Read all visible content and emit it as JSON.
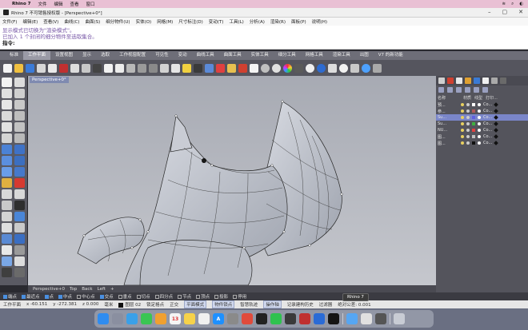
{
  "mac_menu": {
    "app": "Rhino 7",
    "items": [
      "文件",
      "编辑",
      "查看",
      "窗口"
    ],
    "right_icons": [
      "wifi-icon",
      "search-icon",
      "control-center-icon"
    ]
  },
  "window": {
    "title": "Rhino 7 不可销售授权版 - [Perspective+0°]"
  },
  "menu": [
    "文件(F)",
    "编辑(E)",
    "查看(V)",
    "曲线(C)",
    "曲面(S)",
    "细分物件(U)",
    "实体(O)",
    "网格(M)",
    "尺寸标注(D)",
    "变动(T)",
    "工具(L)",
    "分析(A)",
    "渲染(R)",
    "面板(P)",
    "说明(H)"
  ],
  "command": {
    "line1": "显示模式已切换为\"渲染模式\"。",
    "line2": "已加入 1 个封闭的细分物件至选取集合。",
    "prompt": "指令:"
  },
  "toolbar_tabs": [
    "标准",
    "工作平面",
    "设置视图",
    "显示",
    "选取",
    "工作视窗配置",
    "可见性",
    "变动",
    "曲线工具",
    "曲面工具",
    "实体工具",
    "细分工具",
    "网格工具",
    "渲染工具",
    "出图",
    "V7 的新功能"
  ],
  "active_toolbar_tab": 1,
  "viewport": {
    "label": "Perspective+0°"
  },
  "view_tabs": [
    "Perspective+0",
    "Top",
    "Back",
    "Left",
    "+"
  ],
  "osnaps": [
    {
      "label": "端点",
      "on": true
    },
    {
      "label": "最近点",
      "on": true
    },
    {
      "label": "点",
      "on": true
    },
    {
      "label": "中点",
      "on": true
    },
    {
      "label": "中心点",
      "on": false
    },
    {
      "label": "交点",
      "on": true
    },
    {
      "label": "垂点",
      "on": false
    },
    {
      "label": "切点",
      "on": false
    },
    {
      "label": "四分点",
      "on": false
    },
    {
      "label": "节点",
      "on": false
    },
    {
      "label": "顶点",
      "on": false
    },
    {
      "label": "投影",
      "on": false
    },
    {
      "label": "停用",
      "on": false
    }
  ],
  "status": {
    "workplane": "工作平面",
    "x": "x -60.151",
    "y": "y -272.381",
    "z": "z 0.000",
    "unit": "毫米",
    "layer": "图层 02",
    "lock_grid": "锁定格点",
    "ortho": "正交",
    "planar": "平面模式",
    "osnap": "物件锁点",
    "smart_track": "智慧轨迹",
    "gumball": "操作轴",
    "record_history": "记录建构历史",
    "filter": "过滤器",
    "tolerance": "绝对公差: 0.001"
  },
  "tooltip": "Rhino 7",
  "layers": {
    "headers": [
      "名称",
      "材质",
      "线型",
      "打印..."
    ],
    "rows": [
      {
        "name": "预...",
        "color": "#ffffff",
        "selected": false
      },
      {
        "name": "参...",
        "color": "#b05a5a",
        "selected": false
      },
      {
        "name": "Su...",
        "color": "#6060e0",
        "selected": true
      },
      {
        "name": "Su...",
        "color": "#3fb040",
        "selected": false
      },
      {
        "name": "NU...",
        "color": "#e04040",
        "selected": false
      },
      {
        "name": "图...",
        "color": "#c0c0c0",
        "selected": false
      },
      {
        "name": "图...",
        "color": "#101010",
        "selected": false
      }
    ],
    "linetype": "Co..."
  },
  "dock": [
    {
      "name": "finder-icon",
      "color": "#2f8cf0",
      "glyph": ""
    },
    {
      "name": "launchpad-icon",
      "color": "#8a8fa0",
      "glyph": ""
    },
    {
      "name": "safari-icon",
      "color": "#3aa0e8",
      "glyph": ""
    },
    {
      "name": "messages-icon",
      "color": "#3ac553",
      "glyph": ""
    },
    {
      "name": "photos-icon",
      "color": "#f0a030",
      "glyph": ""
    },
    {
      "name": "calendar-icon",
      "color": "#f4f4f4",
      "glyph": "13"
    },
    {
      "name": "notes-icon",
      "color": "#f6d24a",
      "glyph": ""
    },
    {
      "name": "reminders-icon",
      "color": "#f0f0f0",
      "glyph": ""
    },
    {
      "name": "appstore-icon",
      "color": "#1e90ff",
      "glyph": "A"
    },
    {
      "name": "settings-icon",
      "color": "#8a8a8a",
      "glyph": ""
    },
    {
      "name": "chrome-icon",
      "color": "#e04b3c",
      "glyph": ""
    },
    {
      "name": "qq-icon",
      "color": "#222",
      "glyph": ""
    },
    {
      "name": "wechat-icon",
      "color": "#2fc24f",
      "glyph": ""
    },
    {
      "name": "app-icon-1",
      "color": "#3a3a3a",
      "glyph": ""
    },
    {
      "name": "app-icon-2",
      "color": "#c03030",
      "glyph": ""
    },
    {
      "name": "app-icon-3",
      "color": "#2a6bd6",
      "glyph": ""
    },
    {
      "name": "rhino-icon",
      "color": "#151515",
      "glyph": ""
    },
    {
      "name": "folder-icon",
      "color": "#56a6f2",
      "glyph": ""
    },
    {
      "name": "app-icon-4",
      "color": "#e0e0e0",
      "glyph": ""
    },
    {
      "name": "app-icon-5",
      "color": "#555",
      "glyph": ""
    },
    {
      "name": "trash-icon",
      "color": "#c8ccd4",
      "glyph": ""
    }
  ]
}
